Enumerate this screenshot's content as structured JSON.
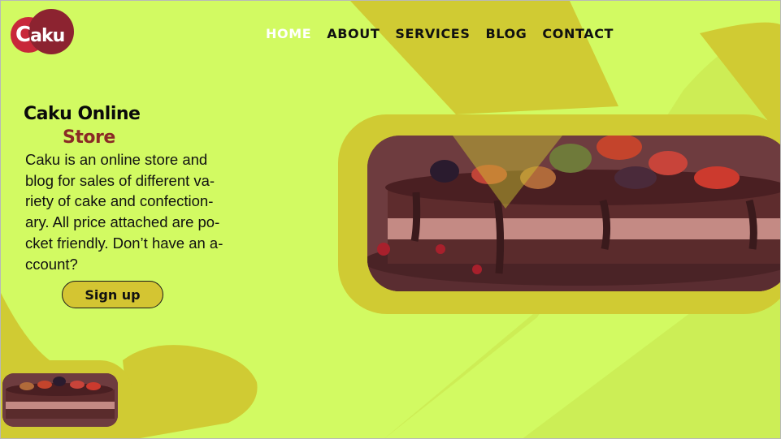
{
  "brand": {
    "logo_text": "aku",
    "logo_letter": "C",
    "colors": {
      "background": "#d2fa62",
      "accent_olive": "#d0cb33",
      "brand_red": "#c8283a",
      "brand_maroon": "#8c2330",
      "store_brown": "#8a2a26"
    }
  },
  "nav": {
    "items": [
      {
        "label": "HOME",
        "active": true
      },
      {
        "label": "ABOUT",
        "active": false
      },
      {
        "label": "SERVICES",
        "active": false
      },
      {
        "label": "BLOG",
        "active": false
      },
      {
        "label": "CONTACT",
        "active": false
      }
    ]
  },
  "hero": {
    "title_line1": "Caku Online",
    "title_line2": "Store",
    "description_lines": [
      "Caku is an online store and",
      "blog for sales of different va-",
      "riety of cake and confection-",
      "ary. All price attached are po-",
      "cket friendly. Don’t  have an a-",
      "ccount?"
    ],
    "signup_label": "Sign up"
  },
  "images": {
    "main": "chocolate-berry-cake-photo",
    "thumbnail": "chocolate-berry-cake-thumbnail"
  }
}
